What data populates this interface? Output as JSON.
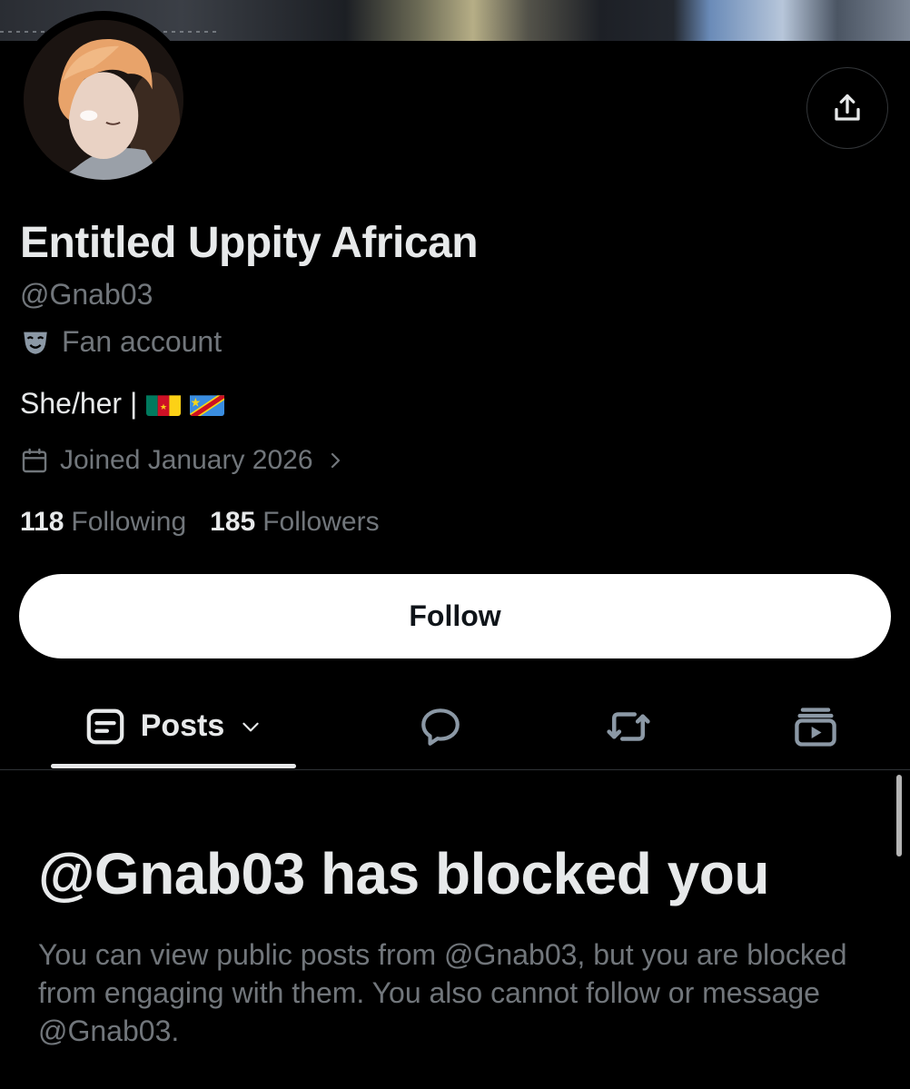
{
  "profile": {
    "display_name": "Entitled Uppity African",
    "handle": "@Gnab03",
    "label": "Fan account",
    "bio_text": "She/her |",
    "joined": "Joined January 2026",
    "following_count": "118",
    "following_label": "Following",
    "followers_count": "185",
    "followers_label": "Followers"
  },
  "actions": {
    "follow_label": "Follow"
  },
  "tabs": {
    "posts_label": "Posts"
  },
  "blocked": {
    "title": "@Gnab03 has blocked you",
    "description": "You can view public posts from @Gnab03, but you are blocked from engaging with them. You also cannot follow or message @Gnab03."
  },
  "icons": {
    "share": "share-icon",
    "mask": "fan-mask-icon",
    "calendar": "calendar-icon",
    "chevron": "chevron-right-icon",
    "posts": "posts-icon",
    "dropdown": "chevron-down-icon",
    "replies": "reply-icon",
    "reposts": "repost-icon",
    "media": "media-icon"
  },
  "colors": {
    "background": "#000000",
    "primary_text": "#e7e9ea",
    "secondary_text": "#71767b",
    "follow_bg": "#ffffff",
    "border": "#2f3336"
  }
}
